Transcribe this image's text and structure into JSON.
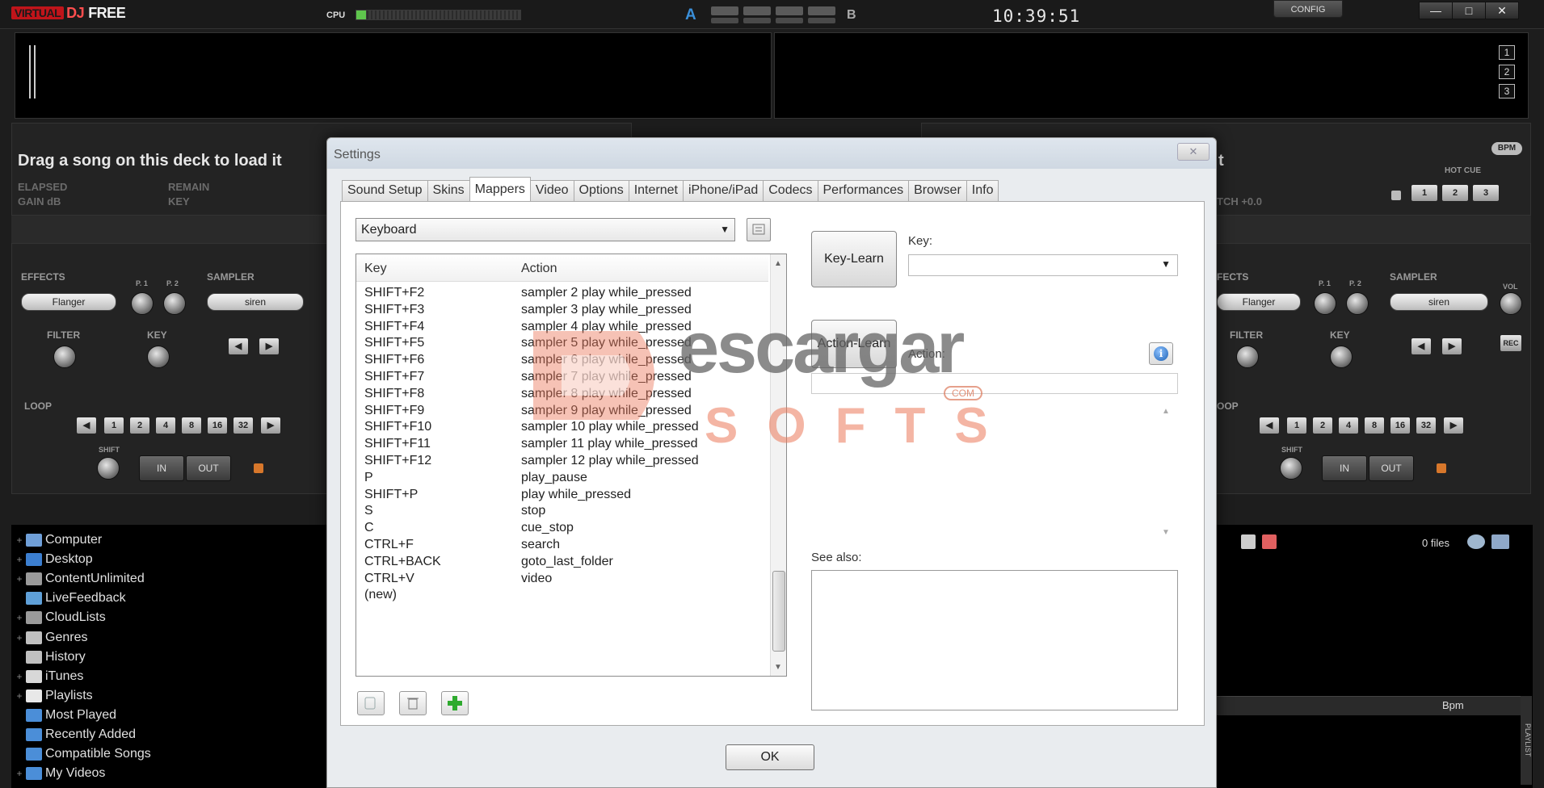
{
  "app": {
    "logo_v": "VIRTUAL",
    "logo_d": "DJ",
    "logo_f": "FREE",
    "cpu_label": "CPU",
    "cpu_fraction": 0.06,
    "deck_a": "A",
    "deck_b": "B",
    "clock": "10:39:51",
    "config_label": "CONFIG",
    "window_buttons": {
      "minimize": "—",
      "maximize": "□",
      "close": "✕"
    },
    "zoom_buttons": [
      "1",
      "2",
      "3"
    ]
  },
  "deck_left": {
    "title": "Drag a song on this deck to load it",
    "elapsed": "ELAPSED",
    "remain": "REMAIN",
    "gain": "GAIN dB",
    "key": "KEY",
    "effects_label": "EFFECTS",
    "effect_value": "Flanger",
    "p1": "P. 1",
    "p2": "P. 2",
    "sampler_label": "SAMPLER",
    "sampler_value": "siren",
    "filter_label": "FILTER",
    "key_knob_label": "KEY",
    "loop_label": "LOOP",
    "loop_sizes": [
      "1",
      "2",
      "4",
      "8",
      "16",
      "32"
    ],
    "shift_label": "SHIFT",
    "in_label": "IN",
    "out_label": "OUT"
  },
  "deck_right": {
    "title_tail": "t",
    "bpm_badge": "BPM",
    "hotcue_label": "HOT CUE",
    "hotcues": [
      "1",
      "2",
      "3"
    ],
    "pitch": "TCH +0.0",
    "effects_label": "FECTS",
    "effect_value": "Flanger",
    "p1": "P. 1",
    "p2": "P. 2",
    "sampler_label": "SAMPLER",
    "sampler_value": "siren",
    "vol_label": "VOL",
    "filter_label": "FILTER",
    "key_knob_label": "KEY",
    "rec_label": "REC",
    "loop_label": "OOP",
    "loop_sizes": [
      "1",
      "2",
      "4",
      "8",
      "16",
      "32"
    ],
    "shift_label": "SHIFT",
    "in_label": "IN",
    "out_label": "OUT"
  },
  "browser": {
    "items": [
      {
        "label": "Computer",
        "expander": "+",
        "icon_color": "#6f9fd8"
      },
      {
        "label": "Desktop",
        "expander": "+",
        "icon_color": "#3c7fd0"
      },
      {
        "label": "ContentUnlimited",
        "expander": "+",
        "icon_color": "#9a9a9a"
      },
      {
        "label": "LiveFeedback",
        "expander": "",
        "icon_color": "#5fa0d8"
      },
      {
        "label": "CloudLists",
        "expander": "+",
        "icon_color": "#9a9a9a"
      },
      {
        "label": "Genres",
        "expander": "+",
        "icon_color": "#c0c0c0"
      },
      {
        "label": "History",
        "expander": "",
        "icon_color": "#c0c0c0"
      },
      {
        "label": "iTunes",
        "expander": "+",
        "icon_color": "#d8d8d8"
      },
      {
        "label": "Playlists",
        "expander": "+",
        "icon_color": "#e8e8e8"
      },
      {
        "label": "Most Played",
        "expander": "",
        "icon_color": "#4b8ed8"
      },
      {
        "label": "Recently Added",
        "expander": "",
        "icon_color": "#4b8ed8"
      },
      {
        "label": "Compatible Songs",
        "expander": "",
        "icon_color": "#4b8ed8"
      },
      {
        "label": "My Videos",
        "expander": "+",
        "icon_color": "#4b8ed8"
      }
    ],
    "files_count": "0 files",
    "bpm_column": "Bpm",
    "side_tab": "PLAYLIST"
  },
  "dialog": {
    "title": "Settings",
    "close": "✕",
    "tabs": [
      {
        "label": "Sound Setup",
        "active": false
      },
      {
        "label": "Skins",
        "active": false
      },
      {
        "label": "Mappers",
        "active": true
      },
      {
        "label": "Video",
        "active": false
      },
      {
        "label": "Options",
        "active": false
      },
      {
        "label": "Internet",
        "active": false
      },
      {
        "label": "iPhone/iPad",
        "active": false
      },
      {
        "label": "Codecs",
        "active": false
      },
      {
        "label": "Performances",
        "active": false
      },
      {
        "label": "Browser",
        "active": false
      },
      {
        "label": "Info",
        "active": false
      }
    ],
    "mapper_selected": "Keyboard",
    "list_header_key": "Key",
    "list_header_action": "Action",
    "mappings": [
      {
        "key": "SHIFT+F2",
        "action": "sampler 2 play while_pressed"
      },
      {
        "key": "SHIFT+F3",
        "action": "sampler 3 play while_pressed"
      },
      {
        "key": "SHIFT+F4",
        "action": "sampler 4 play while_pressed"
      },
      {
        "key": "SHIFT+F5",
        "action": "sampler 5 play while_pressed"
      },
      {
        "key": "SHIFT+F6",
        "action": "sampler 6 play while_pressed"
      },
      {
        "key": "SHIFT+F7",
        "action": "sampler 7 play while_pressed"
      },
      {
        "key": "SHIFT+F8",
        "action": "sampler 8 play while_pressed"
      },
      {
        "key": "SHIFT+F9",
        "action": "sampler 9 play while_pressed"
      },
      {
        "key": "SHIFT+F10",
        "action": "sampler 10 play while_pressed"
      },
      {
        "key": "SHIFT+F11",
        "action": "sampler 11 play while_pressed"
      },
      {
        "key": "SHIFT+F12",
        "action": "sampler 12 play while_pressed"
      },
      {
        "key": "P",
        "action": "play_pause"
      },
      {
        "key": "SHIFT+P",
        "action": "play while_pressed"
      },
      {
        "key": "S",
        "action": "stop"
      },
      {
        "key": "C",
        "action": "cue_stop"
      },
      {
        "key": "CTRL+F",
        "action": "search"
      },
      {
        "key": "CTRL+BACK",
        "action": "goto_last_folder"
      },
      {
        "key": "CTRL+V",
        "action": "video"
      },
      {
        "key": "(new)",
        "action": ""
      }
    ],
    "key_learn": "Key-Learn",
    "key_label": "Key:",
    "key_value": "",
    "action_learn": "Action-Learn",
    "action_label": "Action:",
    "action_value": "",
    "see_also_label": "See also:",
    "ok": "OK"
  },
  "watermark": {
    "big": "escargar",
    "softs": "SOFTS",
    "com": "COM"
  }
}
